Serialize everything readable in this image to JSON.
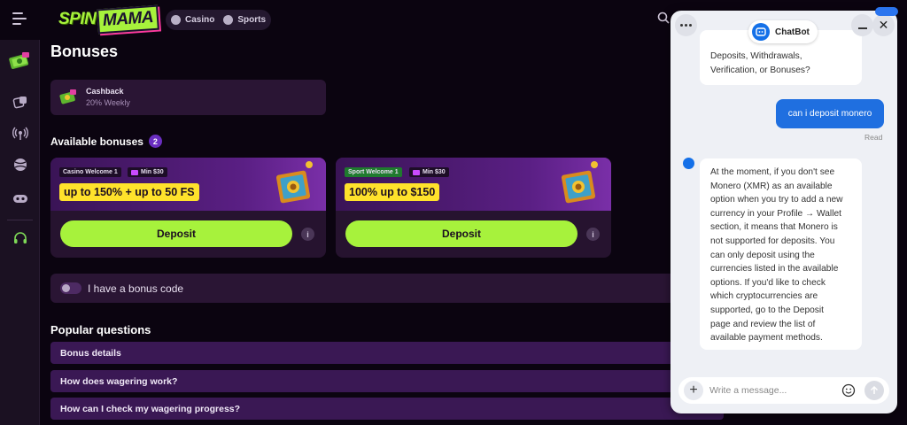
{
  "header": {
    "logo_left": "SPIN",
    "logo_right": "MAMA",
    "nav": [
      {
        "label": "Casino",
        "icon": "casino-icon"
      },
      {
        "label": "Sports",
        "icon": "sports-ball-icon"
      }
    ]
  },
  "sidebar": {
    "items": [
      {
        "name": "promotions",
        "icon": "gift-money-icon"
      },
      {
        "name": "casino",
        "icon": "dice-icon"
      },
      {
        "name": "live",
        "icon": "broadcast-icon"
      },
      {
        "name": "sports",
        "icon": "ball-icon"
      },
      {
        "name": "esports",
        "icon": "gamepad-icon"
      },
      {
        "name": "support",
        "icon": "headset-icon"
      }
    ]
  },
  "page": {
    "title": "Bonuses",
    "cashback": {
      "title": "Cashback",
      "subtitle": "20% Weekly"
    },
    "available_label": "Available bonuses",
    "available_count": "2",
    "bonuses": [
      {
        "type": "Casino Welcome 1",
        "min": "Min $30",
        "amount": "up to 150% + up to 50 FS",
        "button": "Deposit",
        "info": "i"
      },
      {
        "type": "Sport Welcome 1",
        "min": "Min $30",
        "amount": "100% up to $150",
        "button": "Deposit",
        "info": "i"
      }
    ],
    "bonus_code_label": "I have a bonus code",
    "popular_title": "Popular questions",
    "faqs": [
      "Bonus details",
      "How does wagering work?",
      "How can I check my wagering progress?"
    ]
  },
  "chat": {
    "brand": "ChatBot",
    "prev_message_lines": [
      "Deposits, Withdrawals,",
      "Verification, or Bonuses?"
    ],
    "user_message": "can i deposit monero",
    "read_status": "Read",
    "bot_answer_lines": [
      "At the moment, if you don't see",
      "Monero (XMR) as an available",
      "option when you try to add a new",
      "currency in your Profile → Wallet",
      "section, it means that Monero is",
      "not supported for deposits. You",
      "can only deposit using the",
      "currencies listed in the available",
      "options. If you'd like to check",
      "which cryptocurrencies are",
      "supported, go to the Deposit",
      "page and review the list of",
      "available payment methods."
    ],
    "composer_placeholder": "Write a message..."
  },
  "colors": {
    "accent_green": "#a7f23c",
    "amount_yellow": "#ffe22b",
    "chat_blue": "#1f6fe0",
    "page_bg": "#0b0410"
  }
}
